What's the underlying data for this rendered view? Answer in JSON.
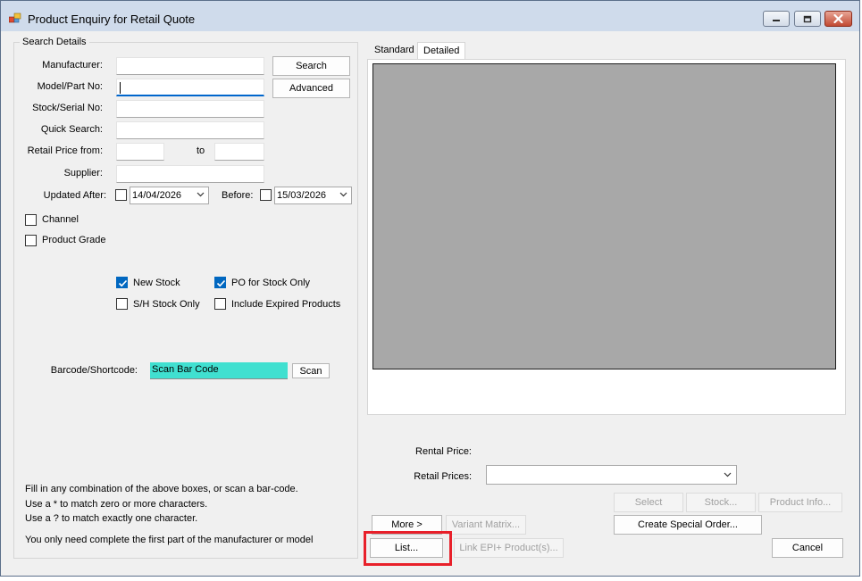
{
  "window": {
    "title": "Product Enquiry for Retail Quote"
  },
  "search_details": {
    "group_title": "Search Details",
    "manufacturer_label": "Manufacturer:",
    "manufacturer_value": "",
    "model_label": "Model/Part No:",
    "model_value": "",
    "stock_serial_label": "Stock/Serial No:",
    "stock_serial_value": "",
    "quick_search_label": "Quick Search:",
    "quick_search_value": "",
    "retail_price_from_label": "Retail Price from:",
    "retail_price_from_value": "",
    "to_label": "to",
    "retail_price_to_value": "",
    "supplier_label": "Supplier:",
    "supplier_value": "",
    "updated_after_label": "Updated After:",
    "updated_after_date": "14/04/2026",
    "before_label": "Before:",
    "before_date": "15/03/2026",
    "search_button": "Search",
    "advanced_button": "Advanced",
    "channel_label": "Channel",
    "product_grade_label": "Product Grade",
    "new_stock_label": "New Stock",
    "po_for_stock_only_label": "PO for Stock Only",
    "sh_stock_only_label": "S/H Stock Only",
    "include_expired_label": "Include Expired Products",
    "barcode_label": "Barcode/Shortcode:",
    "barcode_value": "Scan Bar Code",
    "scan_button": "Scan"
  },
  "checkboxes": {
    "updated_after": false,
    "before": false,
    "channel": false,
    "product_grade": false,
    "new_stock": true,
    "po_for_stock_only": true,
    "sh_stock_only": false,
    "include_expired": false
  },
  "help_text": {
    "line1": "Fill in any combination of the above boxes, or scan a bar-code.",
    "line2": "Use a * to match zero or more characters.",
    "line3": "Use a ? to match exactly one character.",
    "line4": "You only need complete the first part of the manufacturer or model"
  },
  "tabs": [
    {
      "label": "Standard"
    },
    {
      "label": "Detailed"
    }
  ],
  "pricing": {
    "rental_price_label": "Rental Price:",
    "retail_prices_label": "Retail Prices:",
    "retail_prices_value": ""
  },
  "buttons": {
    "select": "Select",
    "stock": "Stock...",
    "product_info": "Product Info...",
    "create_special_order": "Create Special Order...",
    "more": "More >",
    "variant_matrix": "Variant Matrix...",
    "list": "List...",
    "link_epi": "Link EPI+ Product(s)...",
    "cancel": "Cancel"
  },
  "colors": {
    "highlight": "#e8202a",
    "barcode_bg": "#40e0d0",
    "preview_bg": "#a8a8a8",
    "checkbox_checked": "#0067c0"
  }
}
